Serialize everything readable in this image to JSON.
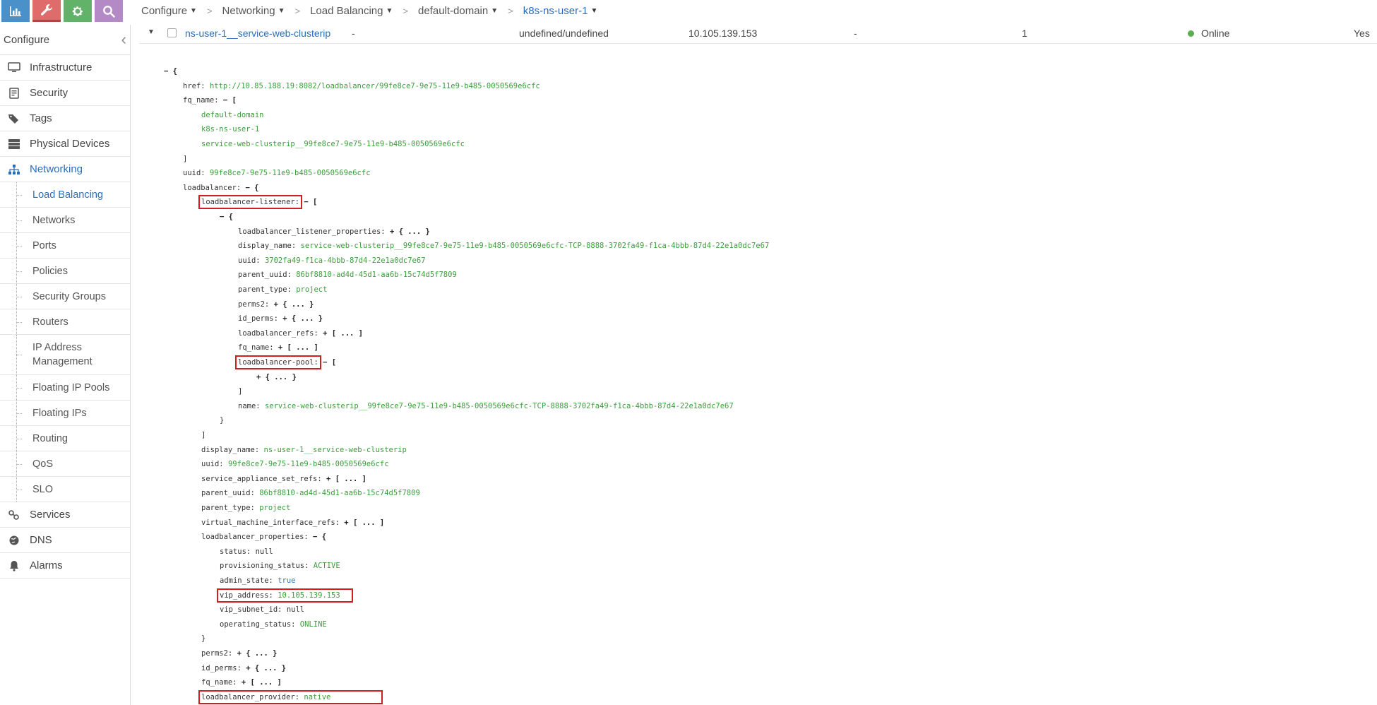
{
  "topnav": {
    "tiles": [
      {
        "name": "monitor",
        "icon": "bar-chart-icon",
        "color": "#4a90c9"
      },
      {
        "name": "configure",
        "icon": "wrench-icon",
        "color": "#e06b6b"
      },
      {
        "name": "settings",
        "icon": "gear-icon",
        "color": "#62b26a"
      },
      {
        "name": "query",
        "icon": "search-icon",
        "color": "#b389c6"
      }
    ]
  },
  "breadcrumb": {
    "items": [
      "Configure",
      "Networking",
      "Load Balancing",
      "default-domain",
      "k8s-ns-user-1"
    ]
  },
  "sidebar": {
    "title": "Configure",
    "items": [
      {
        "label": "Infrastructure",
        "icon": "monitor-icon"
      },
      {
        "label": "Security",
        "icon": "security-icon"
      },
      {
        "label": "Tags",
        "icon": "tags-icon"
      },
      {
        "label": "Physical Devices",
        "icon": "server-icon"
      },
      {
        "label": "Networking",
        "icon": "network-icon",
        "open": true
      },
      {
        "label": "Services",
        "icon": "services-icon"
      },
      {
        "label": "DNS",
        "icon": "globe-icon"
      },
      {
        "label": "Alarms",
        "icon": "bell-icon"
      }
    ],
    "networking_sub": [
      "Load Balancing",
      "Networks",
      "Ports",
      "Policies",
      "Security Groups",
      "Routers",
      "IP Address Management",
      "Floating IP Pools",
      "Floating IPs",
      "Routing",
      "QoS",
      "SLO"
    ]
  },
  "row": {
    "name": "ns-user-1__service-web-clusterip",
    "description": "-",
    "ports": "undefined/undefined",
    "ip": "10.105.139.153",
    "floating_ip": "-",
    "pools": "1",
    "status": "Online",
    "admin_state": "Yes"
  },
  "json": {
    "root_open": "− {",
    "href_key": "href: ",
    "href": "http://10.85.188.19:8082/loadbalancer/99fe8ce7-9e75-11e9-b485-0050569e6cfc",
    "fq_name_key": "fq_name: ",
    "open_bracket": "− [",
    "fq1": "default-domain",
    "fq2": "k8s-ns-user-1",
    "fq3": "service-web-clusterip__99fe8ce7-9e75-11e9-b485-0050569e6cfc",
    "close_bracket": "]",
    "close_brace": "}",
    "uuid_key": "uuid: ",
    "uuid": "99fe8ce7-9e75-11e9-b485-0050569e6cfc",
    "loadbalancer_key": "loadbalancer: ",
    "open_brace": "− {",
    "listener_key": "loadbalancer-listener:",
    "listener_props_key": "loadbalancer_listener_properties: ",
    "collapsed_obj": "+ { ... }",
    "collapsed_arr": "+ [ ... ]",
    "display_name_key": "display_name: ",
    "listener_display_name": "service-web-clusterip__99fe8ce7-9e75-11e9-b485-0050569e6cfc-TCP-8888-3702fa49-f1ca-4bbb-87d4-22e1a0dc7e67",
    "listener_uuid": "3702fa49-f1ca-4bbb-87d4-22e1a0dc7e67",
    "parent_uuid_key": "parent_uuid: ",
    "parent_uuid": "86bf8810-ad4d-45d1-aa6b-15c74d5f7809",
    "parent_type_key": "parent_type: ",
    "parent_type": "project",
    "perms2_key": "perms2: ",
    "id_perms_key": "id_perms: ",
    "lb_refs_key": "loadbalancer_refs: ",
    "pool_key": "loadbalancer-pool:",
    "name_key": "name: ",
    "listener_name": "service-web-clusterip__99fe8ce7-9e75-11e9-b485-0050569e6cfc-TCP-8888-3702fa49-f1ca-4bbb-87d4-22e1a0dc7e67",
    "lb_display_name": "ns-user-1__service-web-clusterip",
    "sas_refs_key": "service_appliance_set_refs: ",
    "vmi_refs_key": "virtual_machine_interface_refs: ",
    "lb_props_key": "loadbalancer_properties: ",
    "status_key": "status: ",
    "status_val": "null",
    "prov_key": "provisioning_status: ",
    "prov_val": "ACTIVE",
    "admin_key": "admin_state: ",
    "admin_val": "true",
    "vip_key": "vip_address: ",
    "vip_val": "10.105.139.153",
    "vip_subnet_key": "vip_subnet_id: ",
    "vip_subnet_val": "null",
    "op_key": "operating_status: ",
    "op_val": "ONLINE",
    "provider_key": "loadbalancer_provider: ",
    "provider_val": "native"
  }
}
